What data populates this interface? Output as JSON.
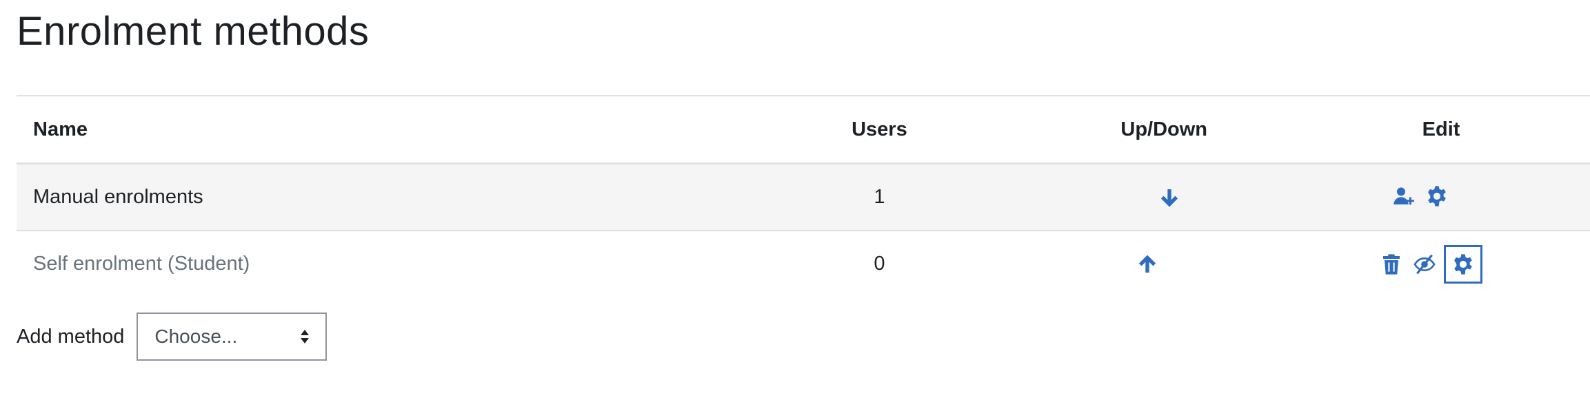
{
  "page": {
    "title": "Enrolment methods"
  },
  "table": {
    "headers": {
      "name": "Name",
      "users": "Users",
      "updown": "Up/Down",
      "edit": "Edit"
    },
    "rows": [
      {
        "name": "Manual enrolments",
        "users": "1",
        "move": "down-arrow-icon",
        "edit_actions": [
          "enrol-users-icon",
          "settings-gear-icon"
        ]
      },
      {
        "name": "Self enrolment (Student)",
        "users": "0",
        "move": "up-arrow-icon",
        "edit_actions": [
          "delete-trash-icon",
          "hide-eye-slash-icon",
          "settings-gear-icon"
        ],
        "muted": true
      }
    ]
  },
  "add_method": {
    "label": "Add method",
    "select_value": "Choose..."
  },
  "colors": {
    "accent": "#2f6cbf",
    "text": "#1d2125",
    "muted_text": "#6a737b",
    "row_stripe": "#f5f5f5",
    "border": "#dee2e6"
  }
}
